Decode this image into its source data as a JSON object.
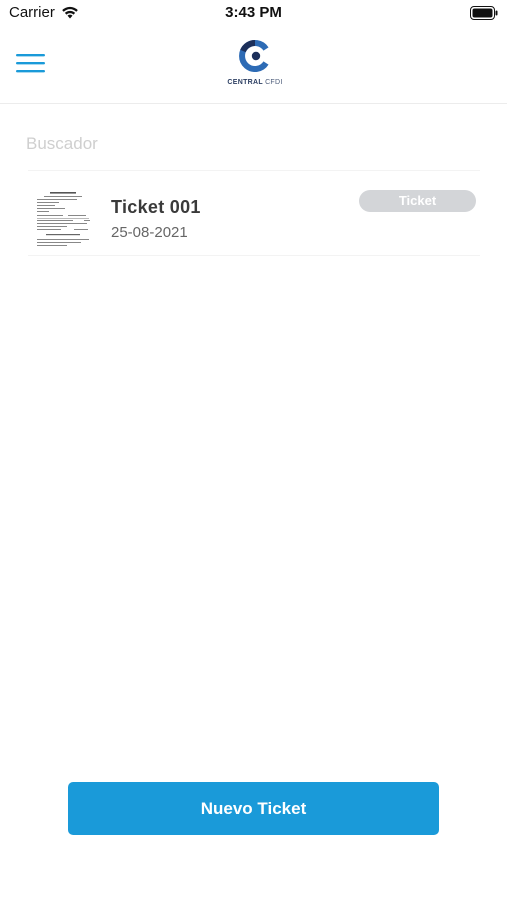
{
  "status_bar": {
    "carrier": "Carrier",
    "time": "3:43 PM",
    "wifi_icon": "wifi-icon",
    "battery_icon": "battery-icon"
  },
  "nav": {
    "menu_icon": "hamburger-menu-icon",
    "logo": {
      "brand_bold": "CENTRAL",
      "brand_light": "CFDI",
      "colors": {
        "primary": "#2d6bb5",
        "accent": "#1c2f5a"
      }
    }
  },
  "search": {
    "placeholder": "Buscador",
    "value": ""
  },
  "tickets": [
    {
      "title": "Ticket 001",
      "date": "25-08-2021",
      "badge": "Ticket",
      "thumb_icon": "receipt-thumbnail"
    }
  ],
  "actions": {
    "new_ticket_label": "Nuevo Ticket"
  },
  "colors": {
    "accent": "#1a9ad9",
    "badge_bg": "#d3d5d8",
    "menu_icon": "#1a9ad9"
  }
}
